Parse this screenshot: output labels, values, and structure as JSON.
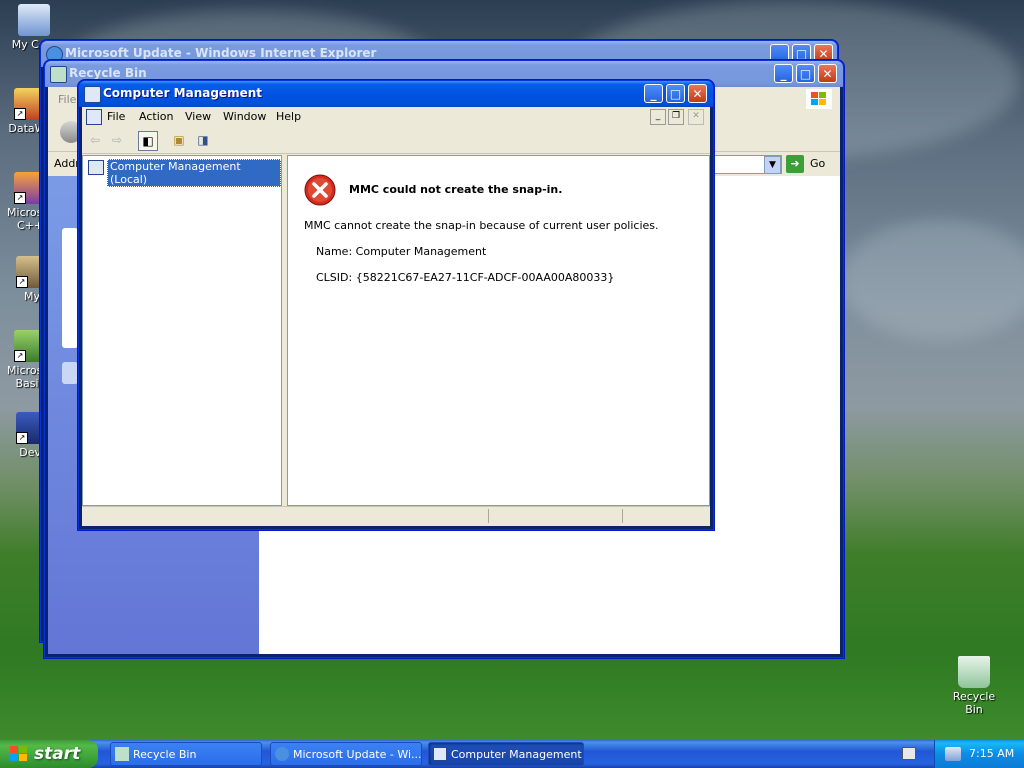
{
  "desktop": {
    "icons": [
      {
        "label": "My Com"
      },
      {
        "label": "DataWa"
      },
      {
        "label": "Microsof C++"
      },
      {
        "label": "My"
      },
      {
        "label": "Microsof Basic"
      },
      {
        "label": "Dev-"
      },
      {
        "label": "Recycle Bin"
      }
    ]
  },
  "ie_window": {
    "title": "Microsoft Update - Windows Internet Explorer"
  },
  "recycle_window": {
    "title": "Recycle Bin",
    "menu_file": "File",
    "address_label": "Addr",
    "go_label": "Go"
  },
  "mmc": {
    "title": "Computer Management",
    "menu": [
      "File",
      "Action",
      "View",
      "Window",
      "Help"
    ],
    "tree_root": "Computer Management (Local)",
    "error": {
      "heading": "MMC could not create the snap-in.",
      "description": "MMC cannot create the snap-in because of current user policies.",
      "name_line": "Name: Computer Management",
      "clsid_line": "CLSID: {58221C67-EA27-11CF-ADCF-00AA00A80033}"
    }
  },
  "taskbar": {
    "start_label": "start",
    "buttons": [
      {
        "label": "Recycle Bin"
      },
      {
        "label": "Microsoft Update - Wi..."
      },
      {
        "label": "Computer Management"
      }
    ],
    "clock": "7:15 AM"
  },
  "colors": {
    "xp_blue": "#0053e1",
    "start_green": "#3a9f36",
    "error_red": "#d62a1e"
  }
}
